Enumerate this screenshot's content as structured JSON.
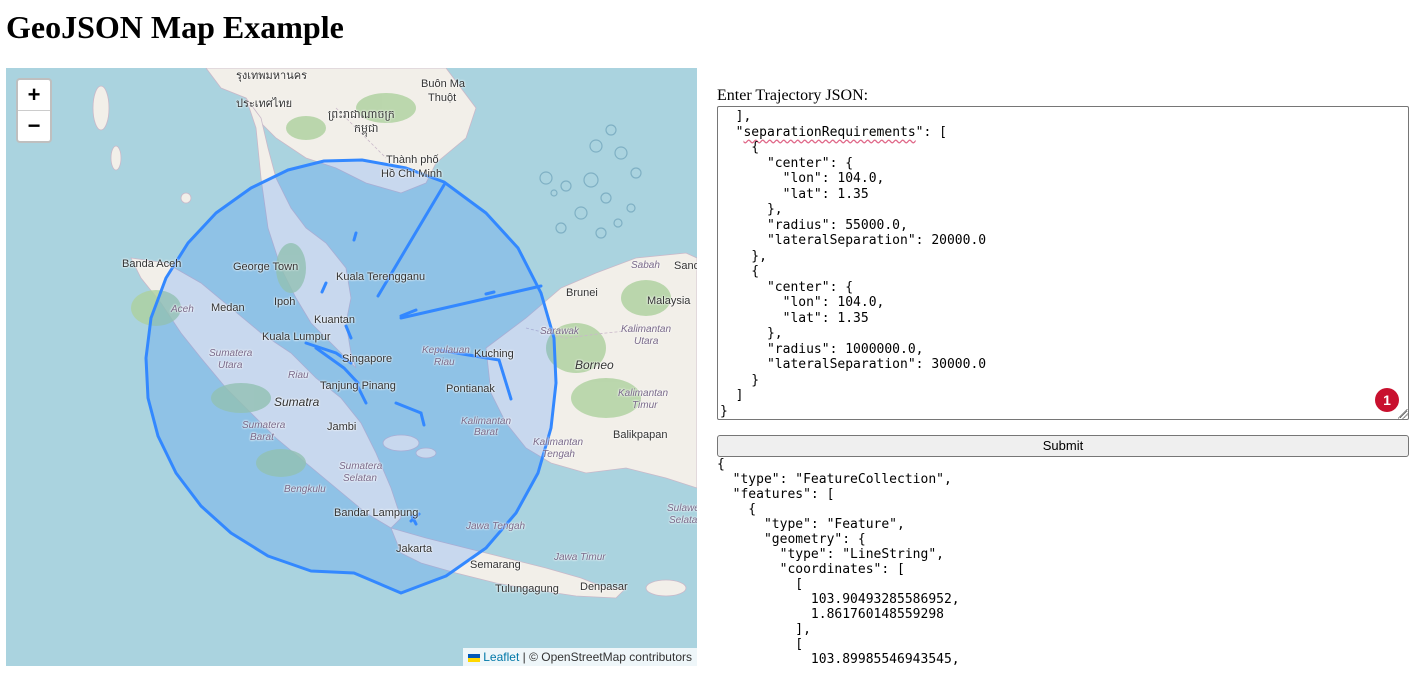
{
  "page": {
    "title": "GeoJSON Map Example"
  },
  "map": {
    "zoom_in": "+",
    "zoom_out": "−",
    "attribution_leaflet": "Leaflet",
    "attribution_rest": " | © OpenStreetMap contributors",
    "labels": [
      "รุงเทพมหานคร",
      "Buôn Ma",
      "Thuột",
      "ประเทศไทย",
      "ព្រះរាជាណាចក្រ",
      "កម្ពុជា",
      "Thành phố",
      "Hồ Chí Minh",
      "Banda Aceh",
      "George Town",
      "Kuala Terengganu",
      "Brunei",
      "Malaysia",
      "Sabah",
      "Sand",
      "Medan",
      "Ipoh",
      "Aceh",
      "Kuantan",
      "Kuala Lumpur",
      "Sarawak",
      "Kalimantan",
      "Utara",
      "Sumatera",
      "Utara",
      "Riau",
      "Singapore",
      "Kepulauan",
      "Riau",
      "Kuching",
      "Borneo",
      "Tanjung Pinang",
      "Pontianak",
      "Sumatra",
      "Kalimantan",
      "Barat",
      "Kalimantan",
      "Timur",
      "Sumatera",
      "Barat",
      "Jambi",
      "Balikpapan",
      "Kalimantan",
      "Tengah",
      "Sumatera",
      "Selatan",
      "Bengkulu",
      "Sulawe",
      "Selata",
      "Bandar Lampung",
      "Jawa Tengah",
      "Jakarta",
      "Jawa Timur",
      "Semarang",
      "Tulungagung",
      "Denpasar"
    ]
  },
  "form": {
    "label": "Enter Trajectory JSON:",
    "textarea_lines": [
      "  ],",
      "  \"separationRequirements\": [",
      "    {",
      "      \"center\": {",
      "        \"lon\": 104.0,",
      "        \"lat\": 1.35",
      "      },",
      "      \"radius\": 55000.0,",
      "      \"lateralSeparation\": 20000.0",
      "    },",
      "    {",
      "      \"center\": {",
      "        \"lon\": 104.0,",
      "        \"lat\": 1.35",
      "      },",
      "      \"radius\": 1000000.0,",
      "      \"lateralSeparation\": 30000.0",
      "    }",
      "  ]",
      "}"
    ],
    "badge_count": "1",
    "submit_label": "Submit"
  },
  "output": {
    "text": "{\n  \"type\": \"FeatureCollection\",\n  \"features\": [\n    {\n      \"type\": \"Feature\",\n      \"geometry\": {\n        \"type\": \"LineString\",\n        \"coordinates\": [\n          [\n            103.90493285586952,\n            1.861760148559298\n          ],\n          [\n            103.89985546943545,"
  },
  "colors": {
    "sea": "#aad3df",
    "land": "#f2efe9",
    "forest": "#add19e",
    "overlay": "#3388ff"
  }
}
